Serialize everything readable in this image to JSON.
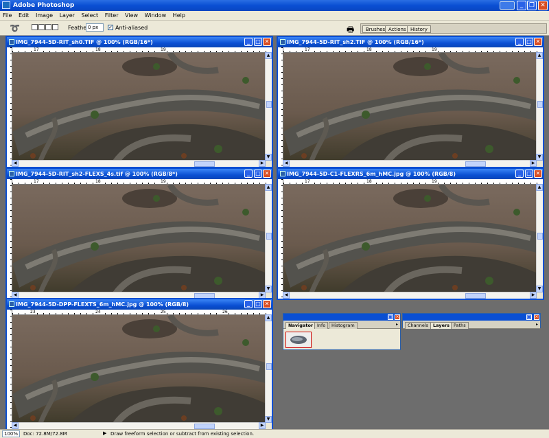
{
  "app": {
    "title": "Adobe Photoshop"
  },
  "menu": [
    "File",
    "Edit",
    "Image",
    "Layer",
    "Select",
    "Filter",
    "View",
    "Window",
    "Help"
  ],
  "options": {
    "feather_label": "Feather:",
    "feather_value": "0 px",
    "antialiased_label": "Anti-aliased",
    "antialiased_checked": true
  },
  "palette_well": {
    "tabs": [
      "Brushes",
      "Actions",
      "History"
    ]
  },
  "documents": [
    {
      "title": "IMG_7944-5D-RIT_sh0.TIF @ 100% (RGB/16*)",
      "ruler": [
        "17",
        "18",
        "19"
      ]
    },
    {
      "title": "IMG_7944-5D-RIT_sh2.TIF @ 100% (RGB/16*)",
      "ruler": [
        "17",
        "18",
        "19"
      ]
    },
    {
      "title": "IMG_7944-5D-RIT_sh2-FLEXS_4s.tif @ 100% (RGB/8*)",
      "ruler": [
        "17",
        "18",
        "19"
      ]
    },
    {
      "title": "IMG_7944-5D-C1-FLEXRS_6m_hMC.jpg @ 100% (RGB/8)",
      "ruler": [
        "17",
        "18",
        "19"
      ]
    },
    {
      "title": "IMG_7944-5D-DPP-FLEXTS_6m_hMC.jpg @ 100% (RGB/8)",
      "ruler": [
        "23",
        "24",
        "25",
        "26"
      ]
    }
  ],
  "navigator_palette": {
    "tabs": [
      "Navigator",
      "Info",
      "Histogram"
    ],
    "active": "Navigator"
  },
  "layers_palette": {
    "tabs": [
      "Channels",
      "Layers",
      "Paths"
    ],
    "active": "Layers"
  },
  "status": {
    "zoom": "100%",
    "doc": "Doc: 72.8M/72.8M",
    "hint": "Draw freeform selection or subtract from existing selection."
  },
  "colors": {
    "title_blue": "#0a4fd3",
    "chrome": "#ece9d8",
    "workspace": "#6d6d6d"
  }
}
